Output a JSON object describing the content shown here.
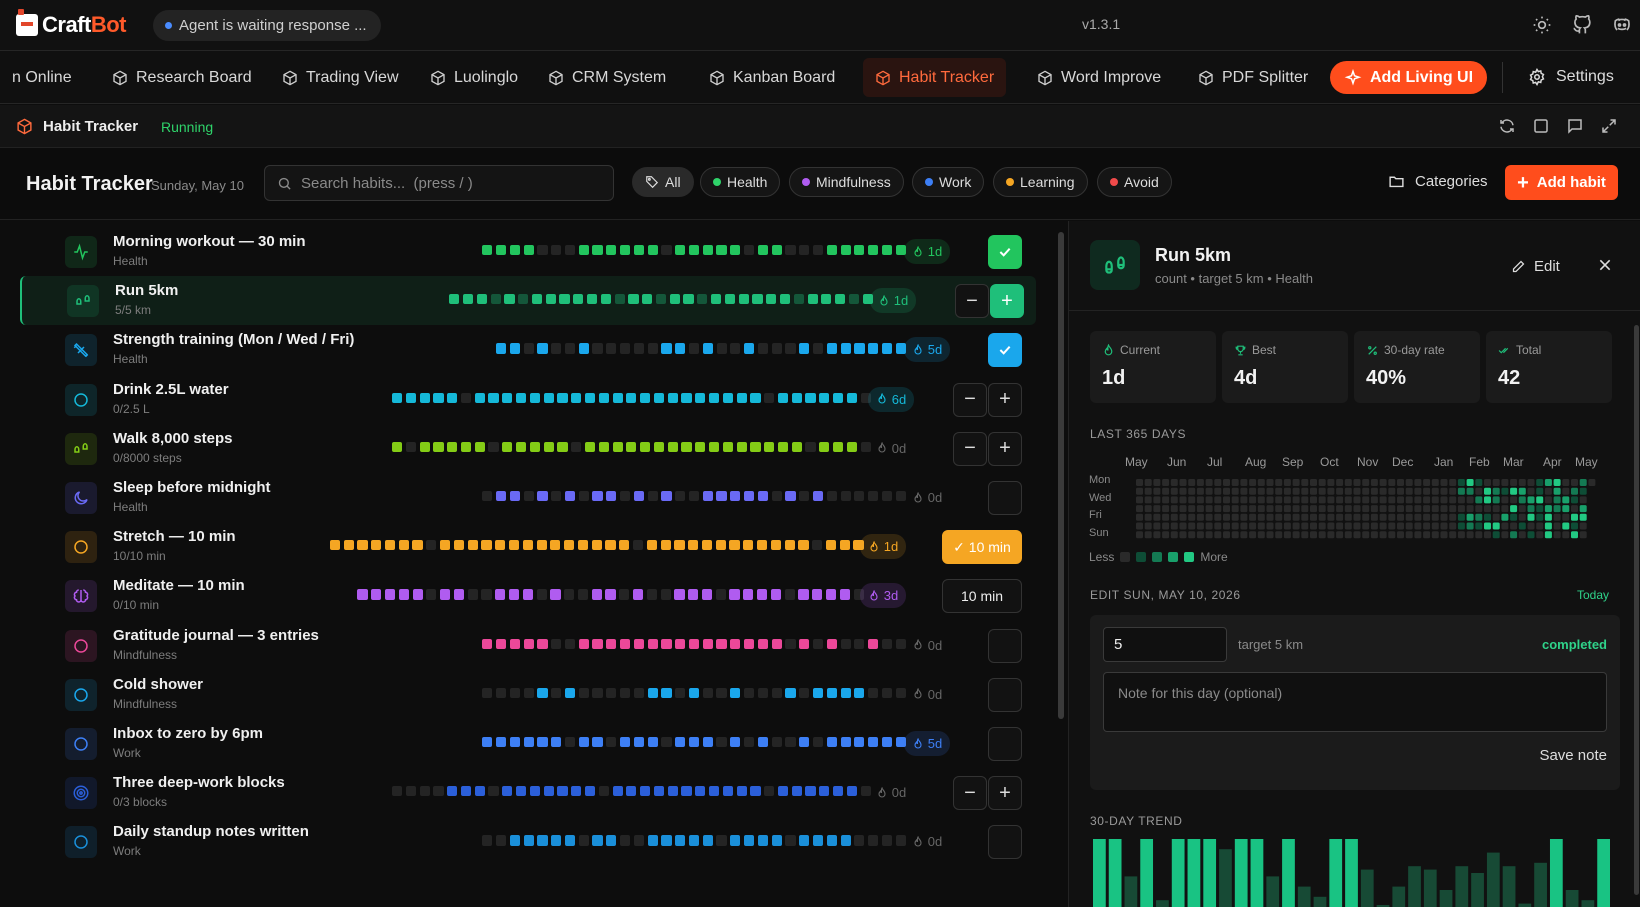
{
  "app": {
    "brand_a": "Craft",
    "brand_b": "Bot",
    "agent_status": "Agent is waiting response ...",
    "version": "v1.3.1"
  },
  "tabs": [
    {
      "label": "n Online",
      "cube": false,
      "active": false,
      "name": "tab-online"
    },
    {
      "label": "Research Board",
      "cube": true,
      "active": false,
      "name": "tab-research-board"
    },
    {
      "label": "Trading View",
      "cube": true,
      "active": false,
      "name": "tab-trading-view"
    },
    {
      "label": "Luolinglo",
      "cube": true,
      "active": false,
      "name": "tab-luolinglo"
    },
    {
      "label": "CRM System",
      "cube": true,
      "active": false,
      "name": "tab-crm-system"
    },
    {
      "label": "Kanban Board",
      "cube": true,
      "active": false,
      "name": "tab-kanban-board"
    },
    {
      "label": "Habit Tracker",
      "cube": true,
      "active": true,
      "name": "tab-habit-tracker"
    },
    {
      "label": "Word Improve",
      "cube": true,
      "active": false,
      "name": "tab-word-improve"
    },
    {
      "label": "PDF Splitter",
      "cube": true,
      "active": false,
      "name": "tab-pdf-splitter"
    }
  ],
  "toolbar": {
    "add_living_ui": "Add Living UI",
    "settings": "Settings"
  },
  "appbar": {
    "name": "Habit Tracker",
    "state": "Running"
  },
  "header": {
    "title": "Habit Tracker",
    "date": "Sunday, May 10",
    "search_placeholder": "Search habits...  (press / )",
    "categories": "Categories",
    "add_habit": "Add habit"
  },
  "filters": [
    {
      "label": "All",
      "color": null,
      "name": "filter-all"
    },
    {
      "label": "Health",
      "color": "#2fd36a",
      "name": "filter-health"
    },
    {
      "label": "Mindfulness",
      "color": "#b05cf0",
      "name": "filter-mindfulness"
    },
    {
      "label": "Work",
      "color": "#3d7ff5",
      "name": "filter-work"
    },
    {
      "label": "Learning",
      "color": "#f5a623",
      "name": "filter-learning"
    },
    {
      "label": "Avoid",
      "color": "#f04a4a",
      "name": "filter-avoid"
    }
  ],
  "habits": [
    {
      "name": "Morning workout — 30 min",
      "sub": "Health",
      "icon": "activity-icon",
      "color": "#22c55e",
      "kind": "check",
      "done": true,
      "streak": "1d",
      "streak_active": true,
      "history": [
        1,
        1,
        1,
        1,
        0,
        0,
        0,
        1,
        1,
        1,
        1,
        1,
        1,
        0,
        1,
        1,
        1,
        1,
        1,
        0,
        1,
        1,
        0,
        0,
        0,
        1,
        1,
        1,
        1,
        1,
        1
      ]
    },
    {
      "name": "Run 5km",
      "sub": "5/5 km",
      "icon": "footprints-icon",
      "color": "#1fbf7a",
      "kind": "count",
      "streak": "1d",
      "streak_active": true,
      "selected": true,
      "history": [
        1,
        1,
        1,
        0,
        1,
        0,
        1,
        1,
        1,
        1,
        1,
        1,
        0,
        1,
        1,
        0,
        1,
        1,
        0,
        1,
        1,
        1,
        1,
        1,
        1,
        0,
        1,
        1,
        1,
        0,
        1
      ]
    },
    {
      "name": "Strength training (Mon / Wed / Fri)",
      "sub": "Health",
      "icon": "dumbbell-icon",
      "color": "#1aa7ec",
      "kind": "check",
      "done": true,
      "streak": "5d",
      "streak_active": true,
      "history": [
        1,
        1,
        0,
        1,
        0,
        0,
        1,
        0,
        0,
        0,
        0,
        0,
        1,
        1,
        0,
        1,
        0,
        0,
        1,
        0,
        0,
        0,
        1,
        0,
        1,
        1,
        1,
        1,
        1,
        1
      ]
    },
    {
      "name": "Drink 2.5L water",
      "sub": "0/2.5 L",
      "icon": "circle-icon",
      "color": "#15b8d8",
      "kind": "count",
      "streak": "6d",
      "streak_active": true,
      "history": [
        1,
        1,
        1,
        1,
        1,
        0,
        1,
        1,
        1,
        1,
        1,
        1,
        1,
        1,
        1,
        1,
        1,
        1,
        1,
        1,
        1,
        1,
        1,
        1,
        1,
        1,
        1,
        0,
        1,
        1,
        1,
        1,
        1,
        1,
        0
      ]
    },
    {
      "name": "Walk 8,000 steps",
      "sub": "0/8000 steps",
      "icon": "footprints-icon",
      "color": "#84cc16",
      "kind": "count",
      "streak": "0d",
      "streak_active": false,
      "history": [
        1,
        0,
        1,
        1,
        1,
        1,
        1,
        0,
        1,
        1,
        1,
        1,
        1,
        0,
        1,
        1,
        1,
        1,
        1,
        1,
        1,
        1,
        1,
        1,
        1,
        1,
        1,
        1,
        1,
        1,
        0,
        1,
        1,
        1,
        0
      ]
    },
    {
      "name": "Sleep before midnight",
      "sub": "Health",
      "icon": "moon-icon",
      "color": "#6a6af5",
      "kind": "check",
      "done": false,
      "streak": "0d",
      "streak_active": false,
      "history": [
        0,
        1,
        1,
        0,
        1,
        0,
        1,
        0,
        1,
        1,
        0,
        1,
        0,
        1,
        0,
        0,
        1,
        1,
        1,
        1,
        1,
        0,
        1,
        0,
        1,
        0,
        0,
        0,
        0,
        0,
        0
      ]
    },
    {
      "name": "Stretch — 10 min",
      "sub": "10/10 min",
      "icon": "circle-icon",
      "color": "#f5a623",
      "kind": "timer",
      "done": true,
      "timer": "✓ 10 min",
      "streak": "1d",
      "streak_active": true,
      "history": [
        1,
        1,
        1,
        1,
        1,
        1,
        1,
        0,
        1,
        1,
        1,
        1,
        1,
        1,
        1,
        1,
        1,
        1,
        1,
        1,
        1,
        1,
        0,
        1,
        1,
        1,
        1,
        1,
        1,
        1,
        1,
        1,
        1,
        1,
        1,
        0,
        1,
        1,
        1
      ]
    },
    {
      "name": "Meditate — 10 min",
      "sub": "0/10 min",
      "icon": "brain-icon",
      "color": "#b05cf0",
      "kind": "timer",
      "done": false,
      "timer": "10 min",
      "streak": "3d",
      "streak_active": true,
      "history": [
        1,
        1,
        1,
        1,
        1,
        0,
        1,
        1,
        0,
        0,
        1,
        1,
        1,
        0,
        1,
        0,
        0,
        1,
        1,
        0,
        1,
        0,
        0,
        1,
        1,
        1,
        0,
        1,
        1,
        1,
        1,
        0,
        1,
        1,
        1,
        1,
        0
      ]
    },
    {
      "name": "Gratitude journal — 3 entries",
      "sub": "Mindfulness",
      "icon": "circle-icon",
      "color": "#ec4899",
      "kind": "check",
      "done": false,
      "streak": "0d",
      "streak_active": false,
      "history": [
        1,
        1,
        1,
        1,
        1,
        0,
        0,
        1,
        1,
        1,
        1,
        1,
        1,
        1,
        1,
        1,
        1,
        1,
        1,
        1,
        1,
        1,
        0,
        1,
        0,
        1,
        0,
        0,
        1,
        0,
        0
      ]
    },
    {
      "name": "Cold shower",
      "sub": "Mindfulness",
      "icon": "circle-icon",
      "color": "#1aa7ec",
      "kind": "check",
      "done": false,
      "streak": "0d",
      "streak_active": false,
      "history": [
        0,
        0,
        0,
        0,
        1,
        0,
        1,
        0,
        0,
        0,
        0,
        0,
        1,
        1,
        0,
        1,
        0,
        0,
        1,
        0,
        0,
        0,
        1,
        0,
        1,
        1,
        1,
        1,
        0,
        0,
        0
      ]
    },
    {
      "name": "Inbox to zero by 6pm",
      "sub": "Work",
      "icon": "circle-icon",
      "color": "#3d7ff5",
      "kind": "check",
      "done": false,
      "streak": "5d",
      "streak_active": true,
      "history": [
        1,
        1,
        1,
        1,
        1,
        1,
        0,
        1,
        1,
        0,
        1,
        1,
        1,
        0,
        1,
        1,
        1,
        0,
        1,
        0,
        1,
        0,
        0,
        1,
        0,
        1,
        1,
        1,
        1,
        1,
        1
      ]
    },
    {
      "name": "Three deep-work blocks",
      "sub": "0/3 blocks",
      "icon": "target-icon",
      "color": "#2b5fd9",
      "kind": "count",
      "streak": "0d",
      "streak_active": false,
      "history": [
        0,
        0,
        0,
        0,
        1,
        1,
        1,
        0,
        1,
        1,
        1,
        1,
        1,
        1,
        1,
        0,
        1,
        1,
        1,
        1,
        1,
        1,
        1,
        1,
        1,
        1,
        1,
        0,
        1,
        1,
        1,
        1,
        1,
        1,
        0
      ]
    },
    {
      "name": "Daily standup notes written",
      "sub": "Work",
      "icon": "circle-icon",
      "color": "#1a8fd9",
      "kind": "check",
      "done": false,
      "streak": "0d",
      "streak_active": false,
      "history": [
        0,
        0,
        1,
        1,
        1,
        1,
        1,
        0,
        1,
        1,
        0,
        0,
        1,
        1,
        1,
        1,
        1,
        0,
        1,
        1,
        1,
        1,
        0,
        1,
        1,
        1,
        1,
        0,
        0,
        0,
        0
      ]
    }
  ],
  "panel": {
    "title": "Run 5km",
    "subtitle": "count • target 5 km • Health",
    "edit": "Edit",
    "stats": [
      {
        "label": "Current",
        "value": "1d",
        "icon": "flame-icon"
      },
      {
        "label": "Best",
        "value": "4d",
        "icon": "trophy-icon"
      },
      {
        "label": "30-day rate",
        "value": "40%",
        "icon": "percent-icon"
      },
      {
        "label": "Total",
        "value": "42",
        "icon": "check-double-icon"
      }
    ],
    "last365_label": "LAST 365 DAYS",
    "months": [
      "May",
      "Jun",
      "Jul",
      "Aug",
      "Sep",
      "Oct",
      "Nov",
      "Dec",
      "Jan",
      "Feb",
      "Mar",
      "Apr",
      "May"
    ],
    "days": [
      "Mon",
      "Wed",
      "Fri",
      "Sun"
    ],
    "legend_less": "Less",
    "legend_more": "More",
    "edit_label": "EDIT SUN, MAY 10, 2026",
    "today": "Today",
    "value": "5",
    "target": "target 5 km",
    "status": "completed",
    "note_placeholder": "Note for this day (optional)",
    "save_note": "Save note",
    "trend_label": "30-DAY TREND",
    "trend": [
      1,
      1,
      0.45,
      1,
      0.1,
      1,
      1,
      1,
      0.85,
      1,
      1,
      0.45,
      1,
      0.3,
      0.15,
      1,
      1,
      0.55,
      0,
      0.3,
      0.6,
      0.55,
      0.25,
      0.6,
      0.5,
      0.8,
      0.6,
      0.05,
      0.65,
      1,
      0.25,
      0.1,
      1
    ]
  },
  "colors": {
    "accent": "#ff4d1c",
    "running": "#2fd36a",
    "selected_green": "#1fbf7a"
  }
}
